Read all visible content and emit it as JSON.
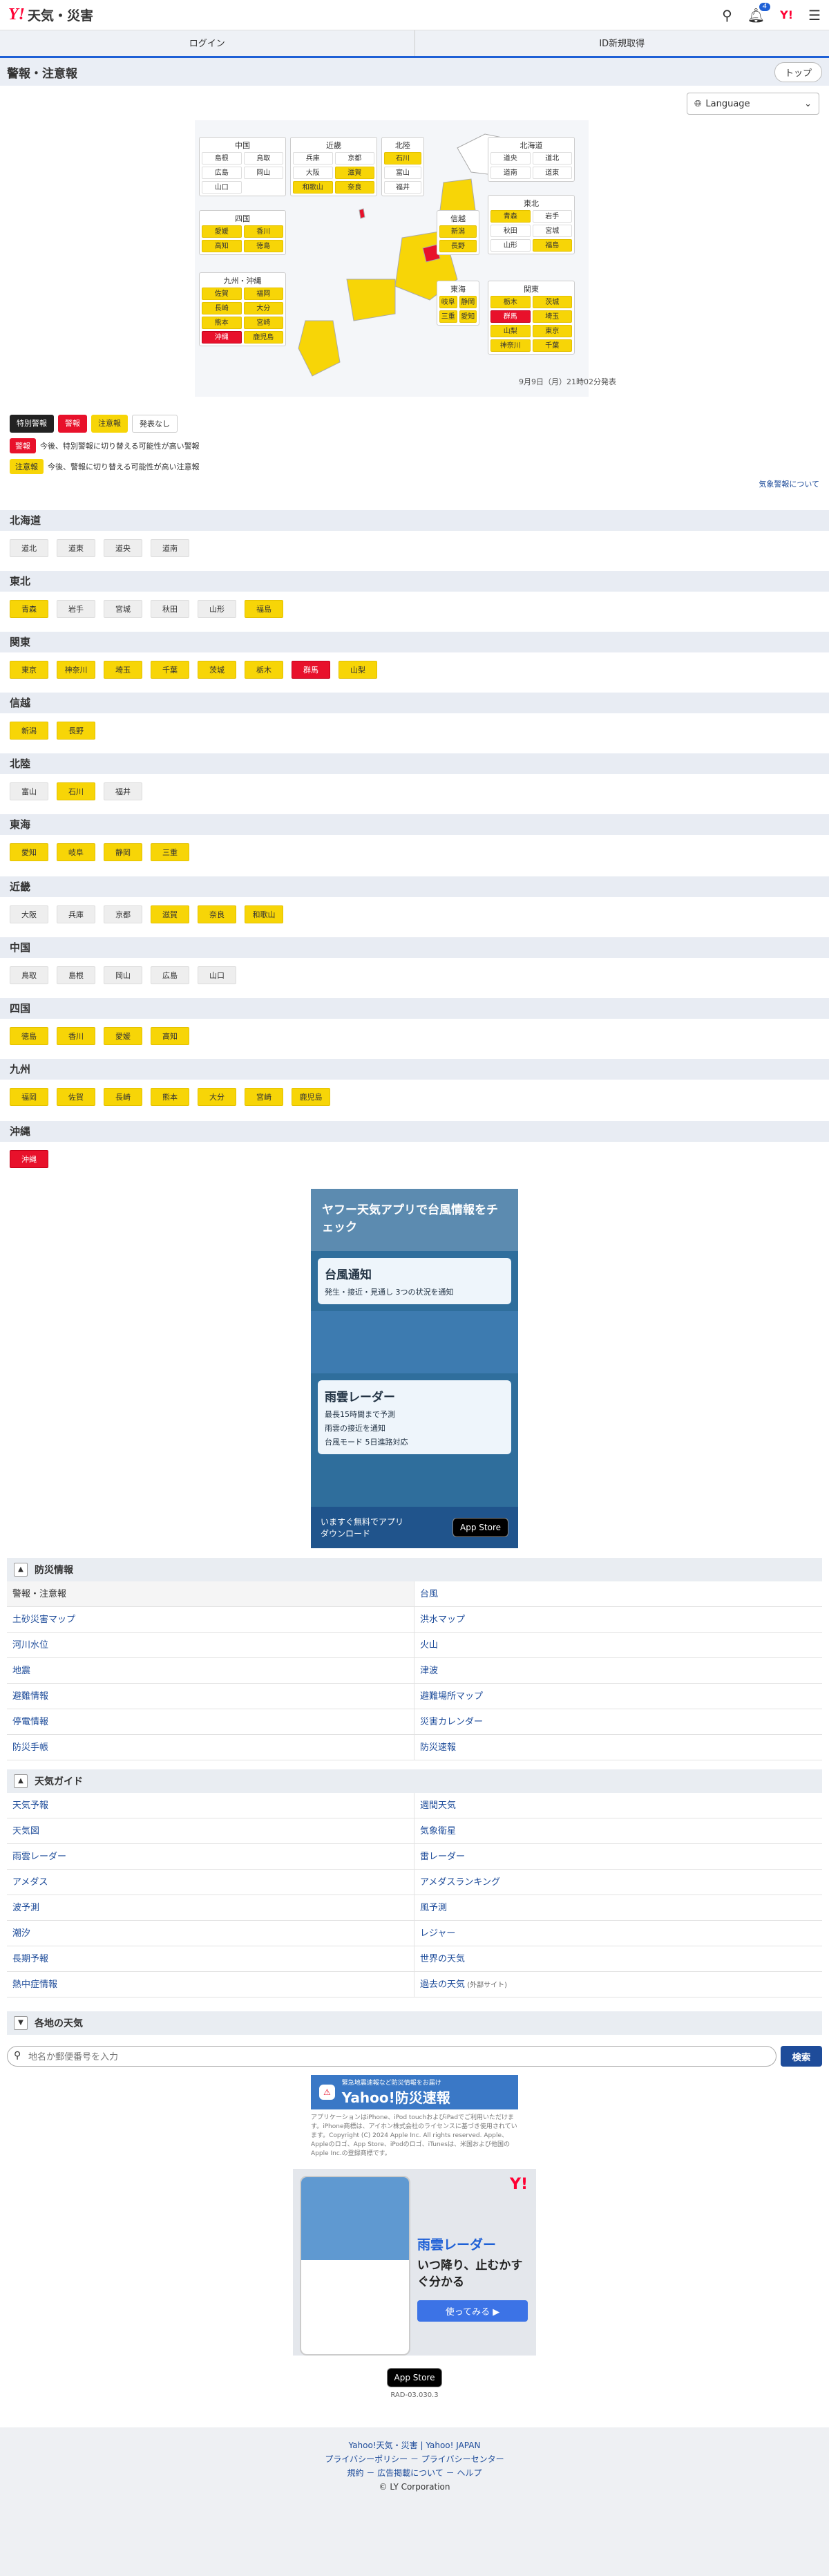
{
  "header": {
    "brand": "天気・災害",
    "notif_count": "4"
  },
  "login": {
    "login": "ログイン",
    "register": "ID新規取得"
  },
  "title": "警報・注意報",
  "top_button": "トップ",
  "language": "Language",
  "map": {
    "date": "9月9日（月）21時02分発表",
    "boxes": {
      "chugoku": {
        "title": "中国",
        "items": [
          {
            "n": "島根",
            "c": "white"
          },
          {
            "n": "鳥取",
            "c": "white"
          },
          {
            "n": "広島",
            "c": "white"
          },
          {
            "n": "岡山",
            "c": "white"
          },
          {
            "n": "山口",
            "c": "white"
          }
        ]
      },
      "kinki": {
        "title": "近畿",
        "items": [
          {
            "n": "兵庫",
            "c": "white"
          },
          {
            "n": "京都",
            "c": "white"
          },
          {
            "n": "大阪",
            "c": "white"
          },
          {
            "n": "滋賀",
            "c": "yellow"
          },
          {
            "n": "和歌山",
            "c": "yellow"
          },
          {
            "n": "奈良",
            "c": "yellow"
          }
        ]
      },
      "hokuriku": {
        "title": "北陸",
        "items": [
          {
            "n": "石川",
            "c": "yellow"
          },
          {
            "n": "富山",
            "c": "white"
          },
          {
            "n": "福井",
            "c": "white"
          }
        ]
      },
      "hokkaido": {
        "title": "北海道",
        "items": [
          {
            "n": "道央",
            "c": "white"
          },
          {
            "n": "道北",
            "c": "white"
          },
          {
            "n": "道南",
            "c": "white"
          },
          {
            "n": "道東",
            "c": "white"
          }
        ]
      },
      "shikoku": {
        "title": "四国",
        "items": [
          {
            "n": "愛媛",
            "c": "yellow"
          },
          {
            "n": "香川",
            "c": "yellow"
          },
          {
            "n": "高知",
            "c": "yellow"
          },
          {
            "n": "徳島",
            "c": "yellow"
          }
        ]
      },
      "tohoku": {
        "title": "東北",
        "items": [
          {
            "n": "青森",
            "c": "yellow"
          },
          {
            "n": "岩手",
            "c": "white"
          },
          {
            "n": "秋田",
            "c": "white"
          },
          {
            "n": "宮城",
            "c": "white"
          },
          {
            "n": "山形",
            "c": "white"
          },
          {
            "n": "福島",
            "c": "yellow"
          }
        ]
      },
      "shinetsu": {
        "title": "信越",
        "items": [
          {
            "n": "新潟",
            "c": "yellow"
          },
          {
            "n": "長野",
            "c": "yellow"
          }
        ]
      },
      "kyushu": {
        "title": "九州・沖縄",
        "items": [
          {
            "n": "佐賀",
            "c": "yellow"
          },
          {
            "n": "福岡",
            "c": "yellow"
          },
          {
            "n": "長崎",
            "c": "yellow"
          },
          {
            "n": "大分",
            "c": "yellow"
          },
          {
            "n": "熊本",
            "c": "yellow"
          },
          {
            "n": "宮崎",
            "c": "yellow"
          },
          {
            "n": "沖縄",
            "c": "red"
          },
          {
            "n": "鹿児島",
            "c": "yellow"
          }
        ]
      },
      "tokai": {
        "title": "東海",
        "items": [
          {
            "n": "岐阜",
            "c": "yellow"
          },
          {
            "n": "静岡",
            "c": "yellow"
          },
          {
            "n": "三重",
            "c": "yellow"
          },
          {
            "n": "愛知",
            "c": "yellow"
          }
        ]
      },
      "kanto": {
        "title": "関東",
        "items": [
          {
            "n": "栃木",
            "c": "yellow"
          },
          {
            "n": "茨城",
            "c": "yellow"
          },
          {
            "n": "群馬",
            "c": "red"
          },
          {
            "n": "埼玉",
            "c": "yellow"
          },
          {
            "n": "山梨",
            "c": "yellow"
          },
          {
            "n": "東京",
            "c": "yellow"
          },
          {
            "n": "神奈川",
            "c": "yellow"
          },
          {
            "n": "千葉",
            "c": "yellow"
          }
        ]
      }
    }
  },
  "legend": {
    "special": "特別警報",
    "warning": "警報",
    "advisory": "注意報",
    "none": "発表なし"
  },
  "notes": {
    "warn_tag": "警報",
    "warn_text": "今後、特別警報に切り替える可能性が高い警報",
    "adv_tag": "注意報",
    "adv_text": "今後、警報に切り替える可能性が高い注意報"
  },
  "kinkyu": "気象警報について",
  "regions": [
    {
      "name": "北海道",
      "items": [
        {
          "n": "道北",
          "c": "gray"
        },
        {
          "n": "道東",
          "c": "gray"
        },
        {
          "n": "道央",
          "c": "gray"
        },
        {
          "n": "道南",
          "c": "gray"
        }
      ]
    },
    {
      "name": "東北",
      "items": [
        {
          "n": "青森",
          "c": "yellow"
        },
        {
          "n": "岩手",
          "c": "gray"
        },
        {
          "n": "宮城",
          "c": "gray"
        },
        {
          "n": "秋田",
          "c": "gray"
        },
        {
          "n": "山形",
          "c": "gray"
        },
        {
          "n": "福島",
          "c": "yellow"
        }
      ]
    },
    {
      "name": "関東",
      "items": [
        {
          "n": "東京",
          "c": "yellow"
        },
        {
          "n": "神奈川",
          "c": "yellow"
        },
        {
          "n": "埼玉",
          "c": "yellow"
        },
        {
          "n": "千葉",
          "c": "yellow"
        },
        {
          "n": "茨城",
          "c": "yellow"
        },
        {
          "n": "栃木",
          "c": "yellow"
        },
        {
          "n": "群馬",
          "c": "red"
        },
        {
          "n": "山梨",
          "c": "yellow"
        }
      ]
    },
    {
      "name": "信越",
      "items": [
        {
          "n": "新潟",
          "c": "yellow"
        },
        {
          "n": "長野",
          "c": "yellow"
        }
      ]
    },
    {
      "name": "北陸",
      "items": [
        {
          "n": "富山",
          "c": "gray"
        },
        {
          "n": "石川",
          "c": "yellow"
        },
        {
          "n": "福井",
          "c": "gray"
        }
      ]
    },
    {
      "name": "東海",
      "items": [
        {
          "n": "愛知",
          "c": "yellow"
        },
        {
          "n": "岐阜",
          "c": "yellow"
        },
        {
          "n": "静岡",
          "c": "yellow"
        },
        {
          "n": "三重",
          "c": "yellow"
        }
      ]
    },
    {
      "name": "近畿",
      "items": [
        {
          "n": "大阪",
          "c": "gray"
        },
        {
          "n": "兵庫",
          "c": "gray"
        },
        {
          "n": "京都",
          "c": "gray"
        },
        {
          "n": "滋賀",
          "c": "yellow"
        },
        {
          "n": "奈良",
          "c": "yellow"
        },
        {
          "n": "和歌山",
          "c": "yellow"
        }
      ]
    },
    {
      "name": "中国",
      "items": [
        {
          "n": "鳥取",
          "c": "gray"
        },
        {
          "n": "島根",
          "c": "gray"
        },
        {
          "n": "岡山",
          "c": "gray"
        },
        {
          "n": "広島",
          "c": "gray"
        },
        {
          "n": "山口",
          "c": "gray"
        }
      ]
    },
    {
      "name": "四国",
      "items": [
        {
          "n": "徳島",
          "c": "yellow"
        },
        {
          "n": "香川",
          "c": "yellow"
        },
        {
          "n": "愛媛",
          "c": "yellow"
        },
        {
          "n": "高知",
          "c": "yellow"
        }
      ]
    },
    {
      "name": "九州",
      "items": [
        {
          "n": "福岡",
          "c": "yellow"
        },
        {
          "n": "佐賀",
          "c": "yellow"
        },
        {
          "n": "長崎",
          "c": "yellow"
        },
        {
          "n": "熊本",
          "c": "yellow"
        },
        {
          "n": "大分",
          "c": "yellow"
        },
        {
          "n": "宮崎",
          "c": "yellow"
        },
        {
          "n": "鹿児島",
          "c": "yellow"
        }
      ]
    },
    {
      "name": "沖縄",
      "items": [
        {
          "n": "沖縄",
          "c": "red"
        }
      ]
    }
  ],
  "ad1": {
    "title": "ヤフー天気アプリで台風情報をチェック",
    "box1": "台風通知",
    "box1sub": "発生・接近・見通し 3つの状況を通知",
    "box2": "雨雲レーダー",
    "box2a": "最長15時間まで予測",
    "box2b": "雨雲の接近を通知",
    "box2c": "台風モード 5日進路対応",
    "cta": "いますぐ無料でアプリダウンロード",
    "store": "App Store"
  },
  "bousai": {
    "title": "防災情報",
    "items": [
      "警報・注意報",
      "台風",
      "土砂災害マップ",
      "洪水マップ",
      "河川水位",
      "火山",
      "地震",
      "津波",
      "避難情報",
      "避難場所マップ",
      "停電情報",
      "災害カレンダー",
      "防災手帳",
      "防災速報"
    ]
  },
  "guide": {
    "title": "天気ガイド",
    "items": [
      "天気予報",
      "週間天気",
      "天気図",
      "気象衛星",
      "雨雲レーダー",
      "雷レーダー",
      "アメダス",
      "アメダスランキング",
      "波予測",
      "風予測",
      "潮汐",
      "レジャー",
      "長期予報",
      "世界の天気",
      "熱中症情報",
      "過去の天気"
    ],
    "ext": "(外部サイト)"
  },
  "local": {
    "title": "各地の天気",
    "placeholder": "地名か郵便番号を入力",
    "button": "検索"
  },
  "ad2": {
    "title": "Yahoo!防災速報",
    "sub": "緊急地震速報など防災情報をお届け",
    "disc": "アプリケーションはiPhone、iPod touchおよびiPadでご利用いただけます。iPhone商標は、アイホン株式会社のライセンスに基づき使用されています。Copyright (C) 2024 Apple Inc. All rights reserved. Apple、Appleのロゴ、App Store、iPodのロゴ、iTunesは、米国および他国のApple Inc.の登録商標です。"
  },
  "ad3": {
    "title": "雨雲レーダー",
    "text": "いつ降り、止むかすぐ分かる",
    "cta": "使ってみる ▶",
    "store": "App Store",
    "code": "RAD-03.030.3"
  },
  "footer": {
    "line1": "Yahoo!天気・災害 | Yahoo! JAPAN",
    "line2": "プライバシーポリシー － プライバシーセンター",
    "line3": "規約 － 広告掲載について － ヘルプ",
    "line4": "© LY Corporation"
  },
  "colors": {
    "yellow": "#f7d507",
    "red": "#e8112b",
    "blue": "#1e60d6"
  }
}
